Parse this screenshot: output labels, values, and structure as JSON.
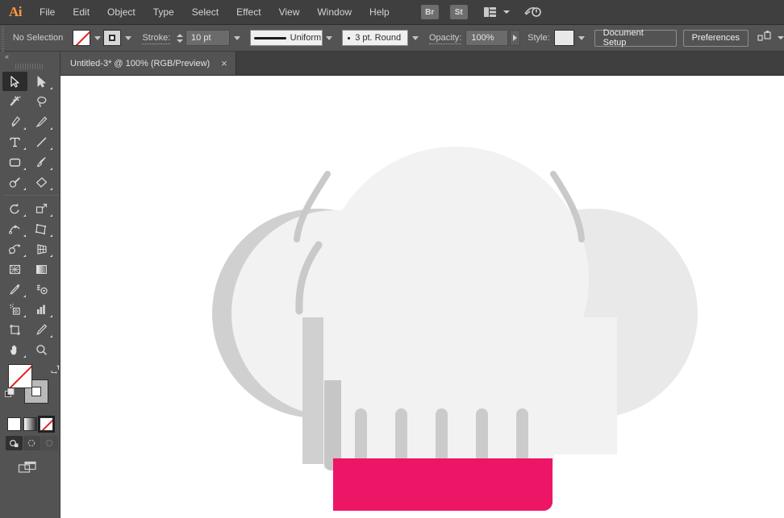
{
  "app": {
    "name": "Adobe Illustrator",
    "logo_text": "Ai"
  },
  "menubar": {
    "items": [
      {
        "label": "File"
      },
      {
        "label": "Edit"
      },
      {
        "label": "Object"
      },
      {
        "label": "Type"
      },
      {
        "label": "Select"
      },
      {
        "label": "Effect"
      },
      {
        "label": "View"
      },
      {
        "label": "Window"
      },
      {
        "label": "Help"
      }
    ],
    "bridge_label": "Br",
    "stock_label": "St",
    "arrange_icon": "arrange-documents-icon",
    "search_icon": "search-adobe-stock-icon"
  },
  "controlbar": {
    "selection_status": "No Selection",
    "fill_swatch": "none",
    "stroke_swatch": "stroke-square",
    "stroke_label": "Stroke:",
    "stroke_weight": "10 pt",
    "stroke_profile": "Uniform",
    "brush_definition": "3 pt. Round",
    "opacity_label": "Opacity:",
    "opacity_value": "100%",
    "style_label": "Style:",
    "document_setup_label": "Document Setup",
    "preferences_label": "Preferences",
    "align_icon": "align-to-artboard-icon"
  },
  "tabbar": {
    "tabs": [
      {
        "title": "Untitled-3* @ 100% (RGB/Preview)",
        "close": "×",
        "active": true
      }
    ]
  },
  "toolbar": {
    "collapse": "«",
    "tools": [
      {
        "name": "selection-tool",
        "active": true,
        "has_flyout": false
      },
      {
        "name": "direct-selection-tool",
        "active": false,
        "has_flyout": true
      },
      {
        "name": "magic-wand-tool",
        "active": false,
        "has_flyout": false
      },
      {
        "name": "lasso-tool",
        "active": false,
        "has_flyout": false
      },
      {
        "name": "pen-tool",
        "active": false,
        "has_flyout": true
      },
      {
        "name": "curvature-tool",
        "active": false,
        "has_flyout": false
      },
      {
        "name": "type-tool",
        "active": false,
        "has_flyout": true
      },
      {
        "name": "line-segment-tool",
        "active": false,
        "has_flyout": true
      },
      {
        "name": "rectangle-tool",
        "active": false,
        "has_flyout": true
      },
      {
        "name": "paintbrush-tool",
        "active": false,
        "has_flyout": true
      },
      {
        "name": "shaper-tool",
        "active": false,
        "has_flyout": true
      },
      {
        "name": "eraser-tool",
        "active": false,
        "has_flyout": true
      },
      {
        "name": "rotate-tool",
        "active": false,
        "has_flyout": true
      },
      {
        "name": "scale-tool",
        "active": false,
        "has_flyout": true
      },
      {
        "name": "width-tool",
        "active": false,
        "has_flyout": true
      },
      {
        "name": "free-transform-tool",
        "active": false,
        "has_flyout": false
      },
      {
        "name": "shape-builder-tool",
        "active": false,
        "has_flyout": true
      },
      {
        "name": "perspective-grid-tool",
        "active": false,
        "has_flyout": true
      },
      {
        "name": "mesh-tool",
        "active": false,
        "has_flyout": false
      },
      {
        "name": "gradient-tool",
        "active": false,
        "has_flyout": false
      },
      {
        "name": "eyedropper-tool",
        "active": false,
        "has_flyout": true
      },
      {
        "name": "blend-tool",
        "active": false,
        "has_flyout": false
      },
      {
        "name": "symbol-sprayer-tool",
        "active": false,
        "has_flyout": true
      },
      {
        "name": "column-graph-tool",
        "active": false,
        "has_flyout": true
      },
      {
        "name": "artboard-tool",
        "active": false,
        "has_flyout": false
      },
      {
        "name": "slice-tool",
        "active": false,
        "has_flyout": true
      },
      {
        "name": "hand-tool",
        "active": false,
        "has_flyout": true
      },
      {
        "name": "zoom-tool",
        "active": false,
        "has_flyout": false
      }
    ],
    "color_controls": {
      "fill": "none",
      "stroke": "gray",
      "swap_icon": "swap-fill-stroke-icon",
      "default_icon": "default-fill-stroke-icon",
      "modes": [
        {
          "name": "color-mode-button",
          "selected": false
        },
        {
          "name": "gradient-mode-button",
          "selected": false
        },
        {
          "name": "none-mode-button",
          "selected": true
        }
      ],
      "draw_modes": [
        {
          "name": "draw-normal-button",
          "selected": true
        },
        {
          "name": "draw-behind-button",
          "selected": false
        },
        {
          "name": "draw-inside-button",
          "selected": false
        }
      ],
      "screen_mode": "change-screen-mode-button"
    }
  },
  "canvas": {
    "background": "#ffffff",
    "artwork_name": "chef-hat-illustration",
    "colors": {
      "hat_front": "#f2f2f2",
      "hat_back": "#d0d0d0",
      "hat_side": "#ebebeb",
      "pleat": "#cbcbcb",
      "band_pink": "#ed1566",
      "stroke_gray": "#c9c9c9"
    }
  }
}
